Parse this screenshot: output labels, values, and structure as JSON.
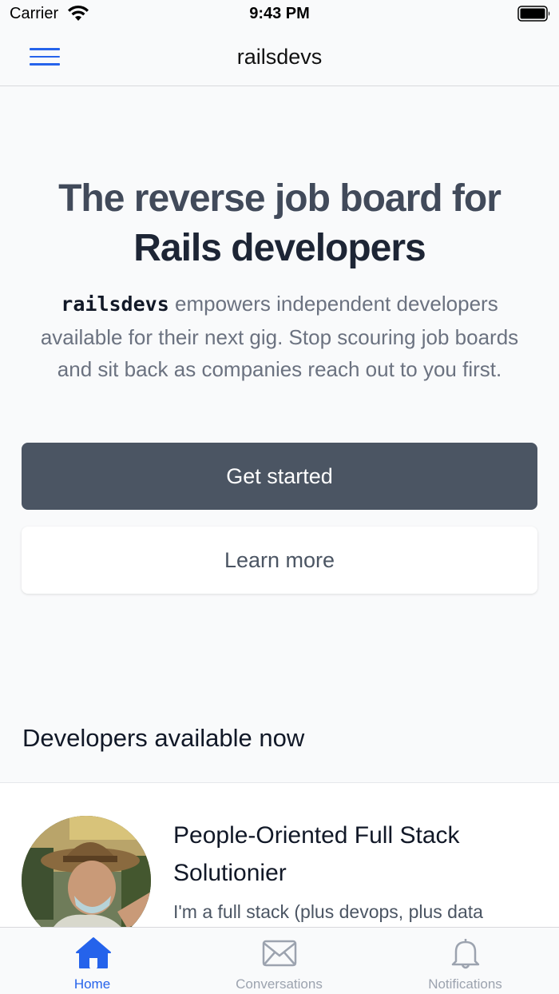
{
  "status_bar": {
    "carrier": "Carrier",
    "time": "9:43 PM",
    "icons": [
      "wifi-icon",
      "battery-icon"
    ]
  },
  "nav": {
    "title": "railsdevs",
    "menu_icon": "hamburger-icon",
    "accent_color": "#2563eb"
  },
  "hero": {
    "title_line1": "The reverse job board for",
    "title_line2": "Rails developers",
    "brand": "railsdevs",
    "description": " empowers independent developers available for their next gig. Stop scouring job boards and sit back as companies reach out to you first.",
    "primary_button": "Get started",
    "secondary_button": "Learn more"
  },
  "developers": {
    "section_title": "Developers available now",
    "items": [
      {
        "title": "People-Oriented Full Stack Solutionier",
        "bio": "I'm a full stack (plus devops, plus data"
      }
    ]
  },
  "tab_bar": {
    "tabs": [
      {
        "label": "Home",
        "icon": "home-icon",
        "active": true
      },
      {
        "label": "Conversations",
        "icon": "envelope-icon",
        "active": false
      },
      {
        "label": "Notifications",
        "icon": "bell-icon",
        "active": false
      }
    ],
    "active_color": "#2563eb",
    "inactive_color": "#9ca3af"
  }
}
